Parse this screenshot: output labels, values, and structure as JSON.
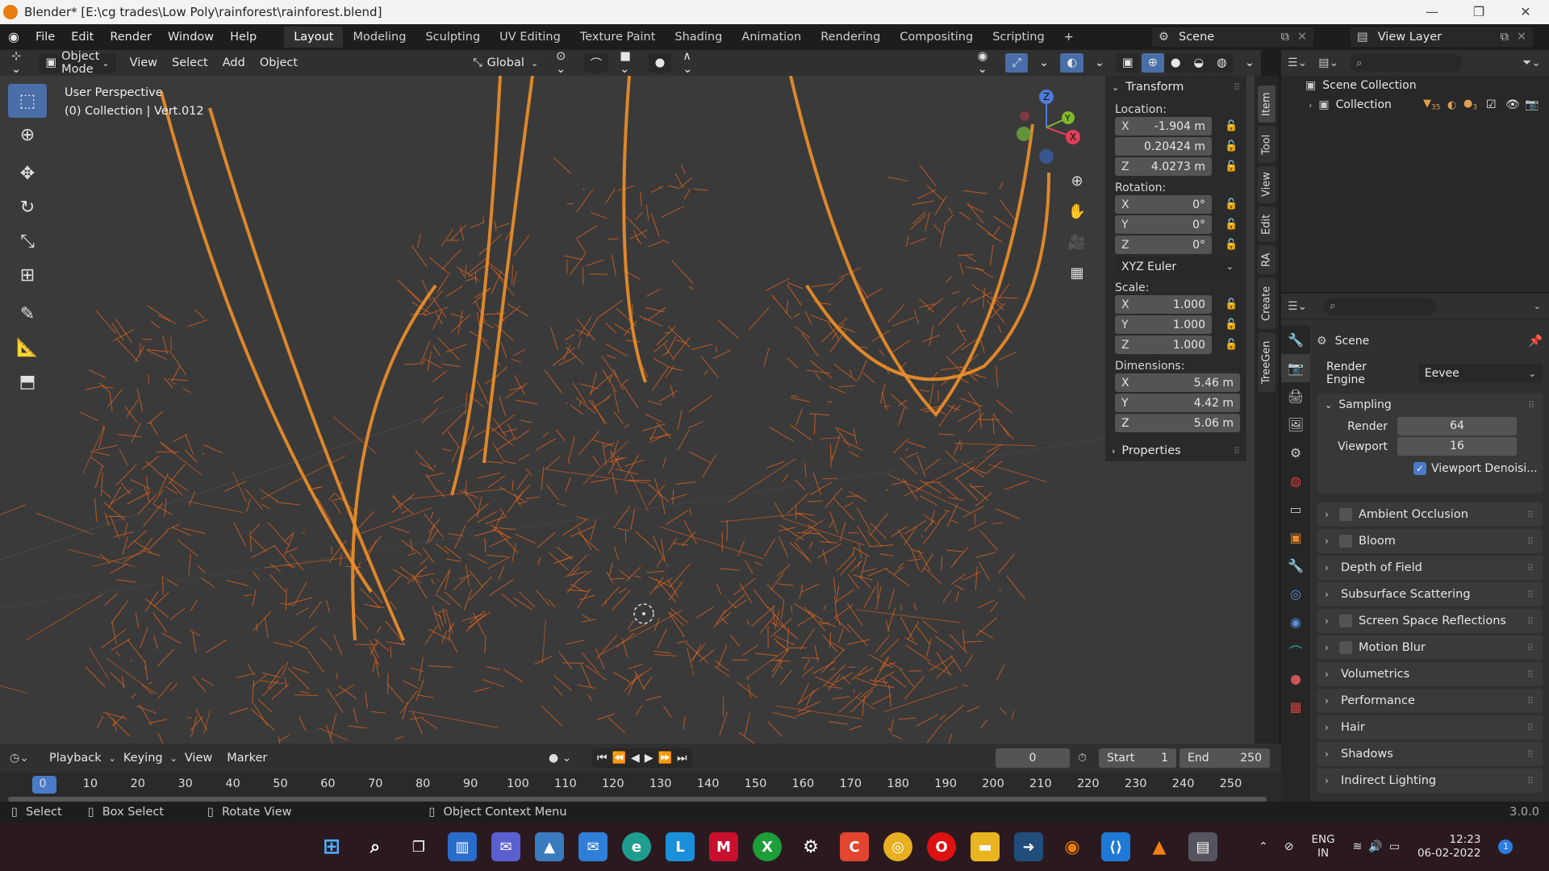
{
  "window": {
    "title": "Blender* [E:\\cg trades\\Low Poly\\rainforest\\rainforest.blend]",
    "minimize": "—",
    "maximize": "❐",
    "close": "✕"
  },
  "menu": [
    "File",
    "Edit",
    "Render",
    "Window",
    "Help"
  ],
  "workspaces": [
    "Layout",
    "Modeling",
    "Sculpting",
    "UV Editing",
    "Texture Paint",
    "Shading",
    "Animation",
    "Rendering",
    "Compositing",
    "Scripting",
    "+"
  ],
  "active_workspace": "Layout",
  "scene_selector": "Scene",
  "view_layer": "View Layer",
  "viewport_header": {
    "mode": "Object Mode",
    "menus": [
      "View",
      "Select",
      "Add",
      "Object"
    ],
    "orientation": "Global"
  },
  "viewport": {
    "perspective": "User Perspective",
    "context": "(0) Collection | Vert.012",
    "wire_color": "#e8651e",
    "bg_color": "#3a3a3a"
  },
  "transform_panel": {
    "header": "Transform",
    "location_label": "Location:",
    "location": [
      [
        "X",
        "-1.904 m"
      ],
      [
        "",
        "0.20424 m"
      ],
      [
        "Z",
        "4.0273 m"
      ]
    ],
    "rotation_label": "Rotation:",
    "rotation": [
      [
        "X",
        "0°"
      ],
      [
        "Y",
        "0°"
      ],
      [
        "Z",
        "0°"
      ]
    ],
    "rotation_mode": "XYZ Euler",
    "scale_label": "Scale:",
    "scale": [
      [
        "X",
        "1.000"
      ],
      [
        "Y",
        "1.000"
      ],
      [
        "Z",
        "1.000"
      ]
    ],
    "dimensions_label": "Dimensions:",
    "dimensions": [
      [
        "X",
        "5.46 m"
      ],
      [
        "Y",
        "4.42 m"
      ],
      [
        "Z",
        "5.06 m"
      ]
    ],
    "properties": "Properties"
  },
  "side_tabs": [
    "Item",
    "Tool",
    "View",
    "Edit",
    "RA",
    "Create",
    "TreeGen"
  ],
  "outliner": {
    "scene_collection": "Scene Collection",
    "collection": "Collection",
    "badge1": "35",
    "badge2": "3"
  },
  "properties": {
    "scene": "Scene",
    "render_engine_label": "Render Engine",
    "render_engine": "Eevee",
    "sampling": "Sampling",
    "render_label": "Render",
    "render_value": "64",
    "viewport_label": "Viewport",
    "viewport_value": "16",
    "denoise": "Viewport Denoisi...",
    "sections": [
      {
        "label": "Ambient Occlusion",
        "checkbox": true
      },
      {
        "label": "Bloom",
        "checkbox": true
      },
      {
        "label": "Depth of Field",
        "checkbox": false
      },
      {
        "label": "Subsurface Scattering",
        "checkbox": false
      },
      {
        "label": "Screen Space Reflections",
        "checkbox": true
      },
      {
        "label": "Motion Blur",
        "checkbox": true
      },
      {
        "label": "Volumetrics",
        "checkbox": false
      },
      {
        "label": "Performance",
        "checkbox": false
      },
      {
        "label": "Hair",
        "checkbox": false
      },
      {
        "label": "Shadows",
        "checkbox": false
      },
      {
        "label": "Indirect Lighting",
        "checkbox": false
      }
    ]
  },
  "timeline": {
    "menus": [
      "Playback",
      "Keying",
      "View",
      "Marker"
    ],
    "current_frame": "0",
    "start_label": "Start",
    "start": "1",
    "end_label": "End",
    "end": "250",
    "ticks": [
      "0",
      "10",
      "20",
      "30",
      "40",
      "50",
      "60",
      "70",
      "80",
      "90",
      "100",
      "110",
      "120",
      "130",
      "140",
      "150",
      "160",
      "170",
      "180",
      "190",
      "200",
      "210",
      "220",
      "230",
      "240",
      "250"
    ]
  },
  "statusbar": {
    "select": "Select",
    "box_select": "Box Select",
    "rotate_view": "Rotate View",
    "context_menu": "Object Context Menu",
    "version": "3.0.0"
  },
  "taskbar": {
    "lang1": "ENG",
    "lang2": "IN",
    "time": "12:23",
    "date": "06-02-2022",
    "notif": "1"
  }
}
